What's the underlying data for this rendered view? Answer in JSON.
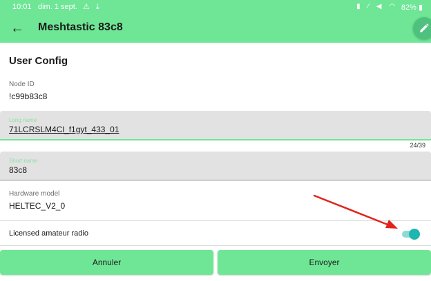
{
  "status_bar": {
    "time": "10:01",
    "date": "dim. 1 sept.",
    "left_icons": "⚠ ⤓",
    "battery": "82%"
  },
  "app_bar": {
    "title": "Meshtastic 83c8",
    "back_icon": "arrow-back-icon",
    "edit_icon": "pencil-icon"
  },
  "user_config": {
    "section_title": "User Config",
    "node_id": {
      "label": "Node ID",
      "value": "!c99b83c8"
    },
    "long_name": {
      "label": "Long name",
      "value": "71LCRSLM4Cl_f1gyt_433_01",
      "counter": "24/39"
    },
    "short_name": {
      "label": "Short name",
      "value": "83c8"
    },
    "hardware_model": {
      "label": "Hardware model",
      "value": "HELTEC_V2_0"
    },
    "licensed": {
      "label": "Licensed amateur radio",
      "enabled": true
    }
  },
  "actions": {
    "cancel_label": "Annuler",
    "send_label": "Envoyer"
  },
  "colors": {
    "accent": "#6ee696",
    "switch_on": "#1fb5b0",
    "annotation_arrow": "#e0241c"
  }
}
